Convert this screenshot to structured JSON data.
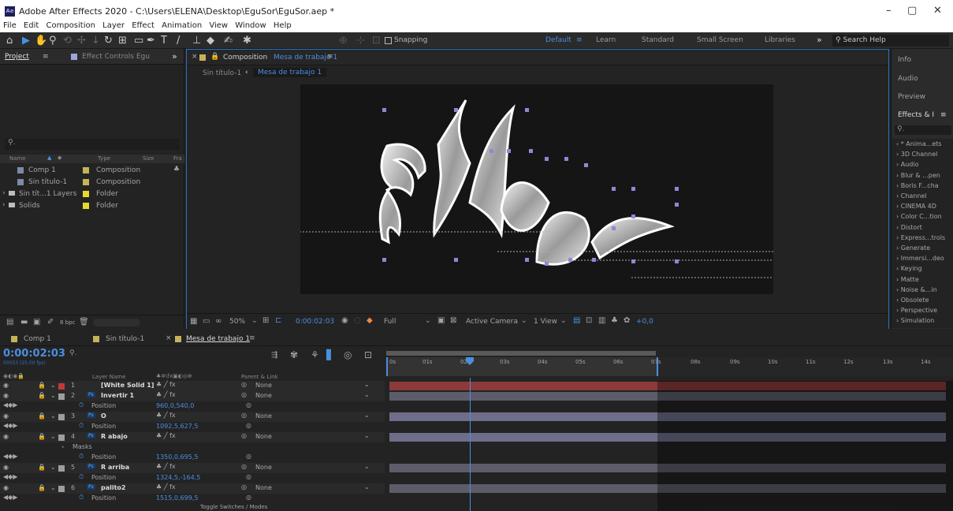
{
  "titlebar": {
    "title": "Adobe After Effects 2020 - C:\\Users\\ELENA\\Desktop\\EguSor\\EguSor.aep *",
    "app_icon": "Ae",
    "min": "–",
    "max": "▢",
    "close": "✕"
  },
  "menu": [
    "File",
    "Edit",
    "Composition",
    "Layer",
    "Effect",
    "Animation",
    "View",
    "Window",
    "Help"
  ],
  "toolbar": {
    "snapping": "Snapping",
    "workspaces": [
      "Default",
      "Learn",
      "Standard",
      "Small Screen",
      "Libraries"
    ],
    "more": "»",
    "search_placeholder": "Search Help"
  },
  "project": {
    "tab": "Project",
    "tab2": "Effect Controls Egu",
    "more": "»",
    "columns": [
      "Name",
      "Type",
      "Size",
      "Fra"
    ],
    "items": [
      {
        "name": "Comp 1",
        "type": "Composition",
        "color": "#c7b25b"
      },
      {
        "name": "Sin título-1",
        "type": "Composition",
        "color": "#c7b25b"
      },
      {
        "name": "Sin tít...1 Layers",
        "type": "Folder",
        "color": "#e6d92e"
      },
      {
        "name": "Solids",
        "type": "Folder",
        "color": "#e6d92e"
      }
    ],
    "bpc": "8 bpc"
  },
  "comp": {
    "header_prefix": "Composition",
    "name": "Mesa de trabajo 1",
    "breadcrumb1": "Sin título-1",
    "breadcrumb2": "Mesa de trabajo 1",
    "zoom": "50%",
    "timecode": "0:00:02:03",
    "quality": "Full",
    "camera": "Active Camera",
    "view": "1 View",
    "exposure": "+0,0"
  },
  "rightdock": {
    "items": [
      "Info",
      "Audio",
      "Preview",
      "Effects & I"
    ],
    "effects": [
      "* Anima...ets",
      "3D Channel",
      "Audio",
      "Blur & ...pen",
      "Boris F...cha",
      "Channel",
      "CINEMA 4D",
      "Color C...tion",
      "Distort",
      "Express...trols",
      "Generate",
      "Immersi...deo",
      "Keying",
      "Matte",
      "Noise &...in",
      "Obsolete",
      "Perspective",
      "Simulation"
    ]
  },
  "timeline": {
    "tabs": [
      "Comp 1",
      "Sin título-1",
      "Mesa de trabajo 1"
    ],
    "timecode": "0:00:02:03",
    "fps": "00053 (25.00 fps)",
    "col_layername": "Layer Name",
    "col_parent": "Parent & Link",
    "ruler": [
      "0s",
      "01s",
      "02s",
      "03s",
      "04s",
      "05s",
      "06s",
      "07s",
      "08s",
      "09s",
      "10s",
      "11s",
      "12s",
      "13s",
      "14s"
    ],
    "footer": "Toggle Switches / Modes",
    "layers": [
      {
        "num": "1",
        "name": "[White Solid 1]",
        "parent": "None",
        "color": "#c03a3a",
        "bar": "#8c3a3a",
        "indent": false
      },
      {
        "num": "2",
        "name": "Invertir 1",
        "parent": "None",
        "color": "#9e9e9e",
        "bar": "#5c5c6a",
        "indent": false,
        "ps": "Ps"
      },
      {
        "prop": "Position",
        "value": "960,0,540,0"
      },
      {
        "num": "3",
        "name": "O",
        "parent": "None",
        "color": "#9e9e9e",
        "bar": "#6e6e8a",
        "ps": "Ps"
      },
      {
        "prop": "Position",
        "value": "1092,5,627,5"
      },
      {
        "num": "4",
        "name": "R abajo",
        "parent": "None",
        "color": "#9e9e9e",
        "bar": "#6e6e8a",
        "ps": "Ps"
      },
      {
        "masks": "Masks"
      },
      {
        "prop": "Position",
        "value": "1350,0,695,5"
      },
      {
        "num": "5",
        "name": "R arriba",
        "parent": "None",
        "color": "#9e9e9e",
        "bar": "#5c5c6a",
        "ps": "Ps"
      },
      {
        "prop": "Position",
        "value": "1324,5,-164,5"
      },
      {
        "num": "6",
        "name": "palito2",
        "parent": "None",
        "color": "#9e9e9e",
        "bar": "#5c5c6a",
        "ps": "Ps"
      },
      {
        "prop": "Position",
        "value": "1515,0,699,5"
      }
    ]
  }
}
